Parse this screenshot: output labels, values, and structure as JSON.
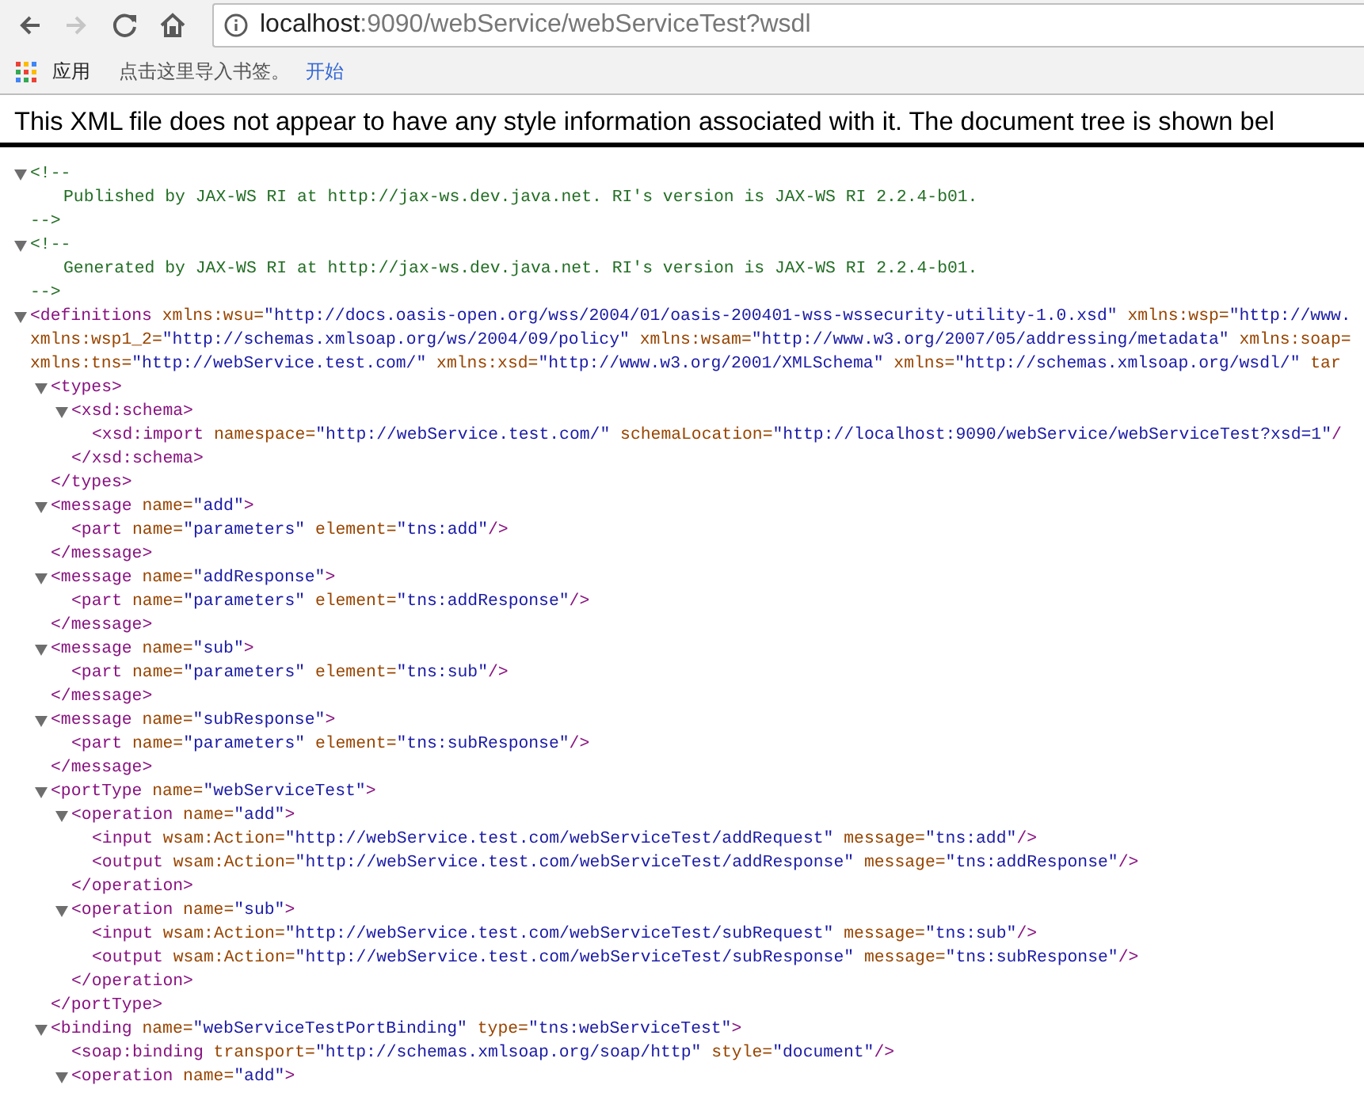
{
  "toolbar": {
    "back": {
      "disabled": false
    },
    "forward": {
      "disabled": true
    },
    "address": {
      "host": "localhost",
      "path": ":9090/webService/webServiceTest?wsdl"
    }
  },
  "bookmarks_bar": {
    "apps": "应用",
    "import_hint": "点击这里导入书签。",
    "start_link": "开始"
  },
  "notice": "This XML file does not appear to have any style information associated with it. The document tree is shown bel",
  "document": [
    {
      "kind": "comment",
      "expanded": true,
      "open": "<!--",
      "text": "Published by JAX-WS RI at http://jax-ws.dev.java.net. RI's version is JAX-WS RI 2.2.4-b01.",
      "close": "-->"
    },
    {
      "kind": "comment",
      "expanded": true,
      "open": "<!--",
      "text": "Generated by JAX-WS RI at http://jax-ws.dev.java.net. RI's version is JAX-WS RI 2.2.4-b01.",
      "close": "-->"
    },
    {
      "kind": "element",
      "expanded": true,
      "open": [
        [
          {
            "kind": "tag",
            "text": "<definitions"
          },
          {
            "kind": "attr",
            "text": " xmlns:wsu="
          },
          {
            "kind": "value",
            "text": "\"http://docs.oasis-open.org/wss/2004/01/oasis-200401-wss-wssecurity-utility-1.0.xsd\""
          },
          {
            "kind": "attr",
            "text": " xmlns:wsp="
          },
          {
            "kind": "value",
            "text": "\"http://www."
          }
        ],
        [
          {
            "kind": "attr",
            "text": "xmlns:wsp1_2="
          },
          {
            "kind": "value",
            "text": "\"http://schemas.xmlsoap.org/ws/2004/09/policy\""
          },
          {
            "kind": "attr",
            "text": " xmlns:wsam="
          },
          {
            "kind": "value",
            "text": "\"http://www.w3.org/2007/05/addressing/metadata\""
          },
          {
            "kind": "attr",
            "text": " xmlns:soap="
          }
        ],
        [
          {
            "kind": "attr",
            "text": "xmlns:tns="
          },
          {
            "kind": "value",
            "text": "\"http://webService.test.com/\""
          },
          {
            "kind": "attr",
            "text": " xmlns:xsd="
          },
          {
            "kind": "value",
            "text": "\"http://www.w3.org/2001/XMLSchema\""
          },
          {
            "kind": "attr",
            "text": " xmlns="
          },
          {
            "kind": "value",
            "text": "\"http://schemas.xmlsoap.org/wsdl/\""
          },
          {
            "kind": "attr",
            "text": " tar"
          }
        ]
      ],
      "children": [
        {
          "kind": "element",
          "expanded": true,
          "open": [
            [
              {
                "kind": "tag",
                "text": "<types>"
              }
            ]
          ],
          "children": [
            {
              "kind": "element",
              "expanded": true,
              "open": [
                [
                  {
                    "kind": "tag",
                    "text": "<xsd:schema>"
                  }
                ]
              ],
              "children": [
                {
                  "kind": "element",
                  "open": [
                    [
                      {
                        "kind": "tag",
                        "text": "<xsd:import"
                      },
                      {
                        "kind": "attr",
                        "text": " namespace="
                      },
                      {
                        "kind": "value",
                        "text": "\"http://webService.test.com/\""
                      },
                      {
                        "kind": "attr",
                        "text": " schemaLocation="
                      },
                      {
                        "kind": "value",
                        "text": "\"http://localhost:9090/webService/webServiceTest?xsd=1\""
                      },
                      {
                        "kind": "tag",
                        "text": "/"
                      }
                    ]
                  ]
                }
              ],
              "close": [
                {
                  "kind": "tag",
                  "text": "</xsd:schema>"
                }
              ]
            }
          ],
          "close": [
            {
              "kind": "tag",
              "text": "</types>"
            }
          ]
        },
        {
          "kind": "element",
          "expanded": true,
          "open": [
            [
              {
                "kind": "tag",
                "text": "<message"
              },
              {
                "kind": "attr",
                "text": " name="
              },
              {
                "kind": "value",
                "text": "\"add\""
              },
              {
                "kind": "tag",
                "text": ">"
              }
            ]
          ],
          "children": [
            {
              "kind": "element",
              "open": [
                [
                  {
                    "kind": "tag",
                    "text": "<part"
                  },
                  {
                    "kind": "attr",
                    "text": " name="
                  },
                  {
                    "kind": "value",
                    "text": "\"parameters\""
                  },
                  {
                    "kind": "attr",
                    "text": " element="
                  },
                  {
                    "kind": "value",
                    "text": "\"tns:add\""
                  },
                  {
                    "kind": "tag",
                    "text": "/>"
                  }
                ]
              ]
            }
          ],
          "close": [
            {
              "kind": "tag",
              "text": "</message>"
            }
          ]
        },
        {
          "kind": "element",
          "expanded": true,
          "open": [
            [
              {
                "kind": "tag",
                "text": "<message"
              },
              {
                "kind": "attr",
                "text": " name="
              },
              {
                "kind": "value",
                "text": "\"addResponse\""
              },
              {
                "kind": "tag",
                "text": ">"
              }
            ]
          ],
          "children": [
            {
              "kind": "element",
              "open": [
                [
                  {
                    "kind": "tag",
                    "text": "<part"
                  },
                  {
                    "kind": "attr",
                    "text": " name="
                  },
                  {
                    "kind": "value",
                    "text": "\"parameters\""
                  },
                  {
                    "kind": "attr",
                    "text": " element="
                  },
                  {
                    "kind": "value",
                    "text": "\"tns:addResponse\""
                  },
                  {
                    "kind": "tag",
                    "text": "/>"
                  }
                ]
              ]
            }
          ],
          "close": [
            {
              "kind": "tag",
              "text": "</message>"
            }
          ]
        },
        {
          "kind": "element",
          "expanded": true,
          "open": [
            [
              {
                "kind": "tag",
                "text": "<message"
              },
              {
                "kind": "attr",
                "text": " name="
              },
              {
                "kind": "value",
                "text": "\"sub\""
              },
              {
                "kind": "tag",
                "text": ">"
              }
            ]
          ],
          "children": [
            {
              "kind": "element",
              "open": [
                [
                  {
                    "kind": "tag",
                    "text": "<part"
                  },
                  {
                    "kind": "attr",
                    "text": " name="
                  },
                  {
                    "kind": "value",
                    "text": "\"parameters\""
                  },
                  {
                    "kind": "attr",
                    "text": " element="
                  },
                  {
                    "kind": "value",
                    "text": "\"tns:sub\""
                  },
                  {
                    "kind": "tag",
                    "text": "/>"
                  }
                ]
              ]
            }
          ],
          "close": [
            {
              "kind": "tag",
              "text": "</message>"
            }
          ]
        },
        {
          "kind": "element",
          "expanded": true,
          "open": [
            [
              {
                "kind": "tag",
                "text": "<message"
              },
              {
                "kind": "attr",
                "text": " name="
              },
              {
                "kind": "value",
                "text": "\"subResponse\""
              },
              {
                "kind": "tag",
                "text": ">"
              }
            ]
          ],
          "children": [
            {
              "kind": "element",
              "open": [
                [
                  {
                    "kind": "tag",
                    "text": "<part"
                  },
                  {
                    "kind": "attr",
                    "text": " name="
                  },
                  {
                    "kind": "value",
                    "text": "\"parameters\""
                  },
                  {
                    "kind": "attr",
                    "text": " element="
                  },
                  {
                    "kind": "value",
                    "text": "\"tns:subResponse\""
                  },
                  {
                    "kind": "tag",
                    "text": "/>"
                  }
                ]
              ]
            }
          ],
          "close": [
            {
              "kind": "tag",
              "text": "</message>"
            }
          ]
        },
        {
          "kind": "element",
          "expanded": true,
          "open": [
            [
              {
                "kind": "tag",
                "text": "<portType"
              },
              {
                "kind": "attr",
                "text": " name="
              },
              {
                "kind": "value",
                "text": "\"webServiceTest\""
              },
              {
                "kind": "tag",
                "text": ">"
              }
            ]
          ],
          "children": [
            {
              "kind": "element",
              "expanded": true,
              "open": [
                [
                  {
                    "kind": "tag",
                    "text": "<operation"
                  },
                  {
                    "kind": "attr",
                    "text": " name="
                  },
                  {
                    "kind": "value",
                    "text": "\"add\""
                  },
                  {
                    "kind": "tag",
                    "text": ">"
                  }
                ]
              ],
              "children": [
                {
                  "kind": "element",
                  "open": [
                    [
                      {
                        "kind": "tag",
                        "text": "<input"
                      },
                      {
                        "kind": "attr",
                        "text": " wsam:Action="
                      },
                      {
                        "kind": "value",
                        "text": "\"http://webService.test.com/webServiceTest/addRequest\""
                      },
                      {
                        "kind": "attr",
                        "text": " message="
                      },
                      {
                        "kind": "value",
                        "text": "\"tns:add\""
                      },
                      {
                        "kind": "tag",
                        "text": "/>"
                      }
                    ]
                  ]
                },
                {
                  "kind": "element",
                  "open": [
                    [
                      {
                        "kind": "tag",
                        "text": "<output"
                      },
                      {
                        "kind": "attr",
                        "text": " wsam:Action="
                      },
                      {
                        "kind": "value",
                        "text": "\"http://webService.test.com/webServiceTest/addResponse\""
                      },
                      {
                        "kind": "attr",
                        "text": " message="
                      },
                      {
                        "kind": "value",
                        "text": "\"tns:addResponse\""
                      },
                      {
                        "kind": "tag",
                        "text": "/>"
                      }
                    ]
                  ]
                }
              ],
              "close": [
                {
                  "kind": "tag",
                  "text": "</operation>"
                }
              ]
            },
            {
              "kind": "element",
              "expanded": true,
              "open": [
                [
                  {
                    "kind": "tag",
                    "text": "<operation"
                  },
                  {
                    "kind": "attr",
                    "text": " name="
                  },
                  {
                    "kind": "value",
                    "text": "\"sub\""
                  },
                  {
                    "kind": "tag",
                    "text": ">"
                  }
                ]
              ],
              "children": [
                {
                  "kind": "element",
                  "open": [
                    [
                      {
                        "kind": "tag",
                        "text": "<input"
                      },
                      {
                        "kind": "attr",
                        "text": " wsam:Action="
                      },
                      {
                        "kind": "value",
                        "text": "\"http://webService.test.com/webServiceTest/subRequest\""
                      },
                      {
                        "kind": "attr",
                        "text": " message="
                      },
                      {
                        "kind": "value",
                        "text": "\"tns:sub\""
                      },
                      {
                        "kind": "tag",
                        "text": "/>"
                      }
                    ]
                  ]
                },
                {
                  "kind": "element",
                  "open": [
                    [
                      {
                        "kind": "tag",
                        "text": "<output"
                      },
                      {
                        "kind": "attr",
                        "text": " wsam:Action="
                      },
                      {
                        "kind": "value",
                        "text": "\"http://webService.test.com/webServiceTest/subResponse\""
                      },
                      {
                        "kind": "attr",
                        "text": " message="
                      },
                      {
                        "kind": "value",
                        "text": "\"tns:subResponse\""
                      },
                      {
                        "kind": "tag",
                        "text": "/>"
                      }
                    ]
                  ]
                }
              ],
              "close": [
                {
                  "kind": "tag",
                  "text": "</operation>"
                }
              ]
            }
          ],
          "close": [
            {
              "kind": "tag",
              "text": "</portType>"
            }
          ]
        },
        {
          "kind": "element",
          "expanded": true,
          "open": [
            [
              {
                "kind": "tag",
                "text": "<binding"
              },
              {
                "kind": "attr",
                "text": " name="
              },
              {
                "kind": "value",
                "text": "\"webServiceTestPortBinding\""
              },
              {
                "kind": "attr",
                "text": " type="
              },
              {
                "kind": "value",
                "text": "\"tns:webServiceTest\""
              },
              {
                "kind": "tag",
                "text": ">"
              }
            ]
          ],
          "children": [
            {
              "kind": "element",
              "open": [
                [
                  {
                    "kind": "tag",
                    "text": "<soap:binding"
                  },
                  {
                    "kind": "attr",
                    "text": " transport="
                  },
                  {
                    "kind": "value",
                    "text": "\"http://schemas.xmlsoap.org/soap/http\""
                  },
                  {
                    "kind": "attr",
                    "text": " style="
                  },
                  {
                    "kind": "value",
                    "text": "\"document\""
                  },
                  {
                    "kind": "tag",
                    "text": "/>"
                  }
                ]
              ]
            },
            {
              "kind": "element",
              "expanded": true,
              "open": [
                [
                  {
                    "kind": "tag",
                    "text": "<operation"
                  },
                  {
                    "kind": "attr",
                    "text": " name="
                  },
                  {
                    "kind": "value",
                    "text": "\"add\""
                  },
                  {
                    "kind": "tag",
                    "text": ">"
                  }
                ]
              ]
            }
          ]
        }
      ]
    }
  ]
}
